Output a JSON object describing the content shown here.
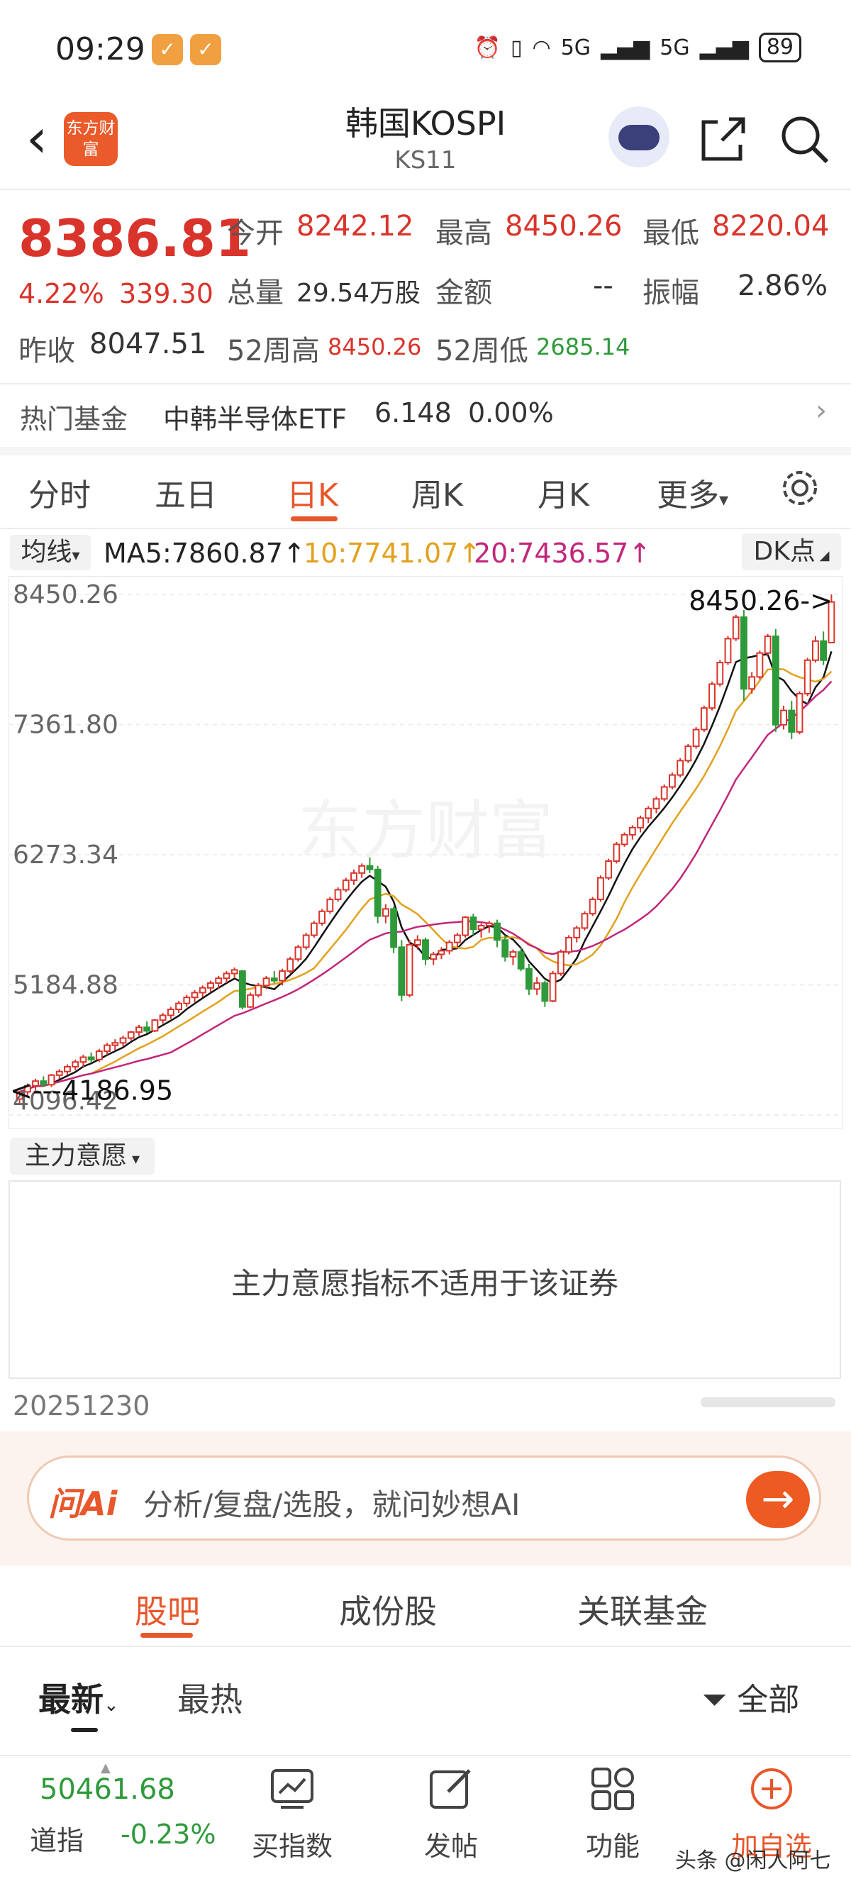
{
  "status": {
    "time": "09:29",
    "signal_1": "5G",
    "signal_2": "5G",
    "battery": "89"
  },
  "header": {
    "logo": "东方财富",
    "title": "韩国KOSPI",
    "code": "KS11"
  },
  "quote": {
    "price": "8386.81",
    "change_pct": "4.22%",
    "change_abs": "339.30",
    "open_label": "今开",
    "open": "8242.12",
    "high_label": "最高",
    "high": "8450.26",
    "low_label": "最低",
    "low": "8220.04",
    "volume_label": "总量",
    "volume": "29.54万股",
    "amount_label": "金额",
    "amount": "--",
    "amplitude_label": "振幅",
    "amplitude": "2.86%",
    "prev_close_label": "昨收",
    "prev_close": "8047.51",
    "wk52_high_label": "52周高",
    "wk52_high": "8450.26",
    "wk52_low_label": "52周低",
    "wk52_low": "2685.14"
  },
  "hot_fund": {
    "label": "热门基金",
    "name": "中韩半导体ETF",
    "price": "6.148",
    "change": "0.00%",
    "arrow": "›"
  },
  "chart_tabs": [
    "分时",
    "五日",
    "日K",
    "周K",
    "月K",
    "更多"
  ],
  "ma": {
    "selector": "均线",
    "ma5": "MA5:7860.87↑",
    "ma10": "10:7741.07↑",
    "ma20": "20:7436.57↑",
    "dk_button": "DK点"
  },
  "chart_data": {
    "type": "candlestick",
    "y_ticks": [
      "8450.26",
      "7361.80",
      "6273.34",
      "5184.88",
      "4096.42"
    ],
    "ylim": [
      4096.42,
      8450.26
    ],
    "max_annotation": "8450.26->",
    "min_annotation": "<---4186.95",
    "watermark": "东方财富",
    "series": [
      {
        "name": "MA5",
        "color": "#111111"
      },
      {
        "name": "MA10",
        "color": "#e2a11e"
      },
      {
        "name": "MA20",
        "color": "#c2267a"
      }
    ],
    "candles": [
      [
        4230,
        4300,
        4187,
        4290
      ],
      [
        4290,
        4360,
        4260,
        4340
      ],
      [
        4340,
        4400,
        4300,
        4380
      ],
      [
        4380,
        4420,
        4330,
        4350
      ],
      [
        4350,
        4440,
        4330,
        4430
      ],
      [
        4430,
        4480,
        4400,
        4460
      ],
      [
        4460,
        4520,
        4430,
        4500
      ],
      [
        4500,
        4560,
        4470,
        4540
      ],
      [
        4540,
        4600,
        4500,
        4580
      ],
      [
        4580,
        4620,
        4530,
        4560
      ],
      [
        4560,
        4650,
        4540,
        4630
      ],
      [
        4630,
        4700,
        4600,
        4680
      ],
      [
        4680,
        4730,
        4640,
        4700
      ],
      [
        4700,
        4760,
        4670,
        4740
      ],
      [
        4740,
        4800,
        4720,
        4790
      ],
      [
        4790,
        4850,
        4760,
        4830
      ],
      [
        4830,
        4880,
        4780,
        4800
      ],
      [
        4800,
        4900,
        4790,
        4890
      ],
      [
        4890,
        4950,
        4860,
        4930
      ],
      [
        4930,
        5000,
        4900,
        4980
      ],
      [
        4980,
        5050,
        4950,
        5030
      ],
      [
        5030,
        5100,
        5000,
        5080
      ],
      [
        5080,
        5140,
        5040,
        5120
      ],
      [
        5120,
        5180,
        5080,
        5160
      ],
      [
        5160,
        5220,
        5120,
        5200
      ],
      [
        5200,
        5260,
        5150,
        5240
      ],
      [
        5240,
        5300,
        5200,
        5280
      ],
      [
        5280,
        5330,
        5240,
        5310
      ],
      [
        5300,
        5310,
        4980,
        5000
      ],
      [
        5000,
        5120,
        4990,
        5100
      ],
      [
        5100,
        5200,
        5080,
        5180
      ],
      [
        5180,
        5260,
        5150,
        5240
      ],
      [
        5240,
        5300,
        5200,
        5220
      ],
      [
        5220,
        5320,
        5180,
        5300
      ],
      [
        5300,
        5420,
        5280,
        5400
      ],
      [
        5400,
        5520,
        5380,
        5500
      ],
      [
        5500,
        5620,
        5480,
        5600
      ],
      [
        5600,
        5720,
        5580,
        5700
      ],
      [
        5700,
        5820,
        5680,
        5800
      ],
      [
        5800,
        5920,
        5780,
        5900
      ],
      [
        5900,
        6000,
        5880,
        5980
      ],
      [
        5980,
        6080,
        5960,
        6060
      ],
      [
        6060,
        6150,
        6020,
        6120
      ],
      [
        6120,
        6200,
        6080,
        6180
      ],
      [
        6180,
        6250,
        6120,
        6150
      ],
      [
        6150,
        6180,
        5700,
        5760
      ],
      [
        5760,
        5860,
        5700,
        5820
      ],
      [
        5820,
        5840,
        5450,
        5500
      ],
      [
        5500,
        5560,
        5050,
        5100
      ],
      [
        5100,
        5560,
        5080,
        5520
      ],
      [
        5520,
        5600,
        5480,
        5560
      ],
      [
        5560,
        5580,
        5350,
        5400
      ],
      [
        5400,
        5460,
        5350,
        5440
      ],
      [
        5440,
        5500,
        5400,
        5470
      ],
      [
        5470,
        5560,
        5440,
        5540
      ],
      [
        5540,
        5620,
        5500,
        5600
      ],
      [
        5600,
        5760,
        5580,
        5750
      ],
      [
        5750,
        5780,
        5600,
        5650
      ],
      [
        5650,
        5700,
        5580,
        5680
      ],
      [
        5680,
        5720,
        5620,
        5700
      ],
      [
        5700,
        5730,
        5500,
        5560
      ],
      [
        5560,
        5600,
        5380,
        5420
      ],
      [
        5420,
        5480,
        5350,
        5460
      ],
      [
        5460,
        5500,
        5300,
        5320
      ],
      [
        5320,
        5360,
        5100,
        5150
      ],
      [
        5150,
        5250,
        5100,
        5200
      ],
      [
        5200,
        5220,
        5000,
        5050
      ],
      [
        5050,
        5300,
        5040,
        5280
      ],
      [
        5280,
        5480,
        5260,
        5460
      ],
      [
        5460,
        5600,
        5440,
        5580
      ],
      [
        5580,
        5680,
        5540,
        5660
      ],
      [
        5660,
        5800,
        5640,
        5780
      ],
      [
        5780,
        5920,
        5760,
        5900
      ],
      [
        5900,
        6100,
        5880,
        6080
      ],
      [
        6080,
        6240,
        6060,
        6220
      ],
      [
        6220,
        6380,
        6200,
        6360
      ],
      [
        6360,
        6460,
        6340,
        6440
      ],
      [
        6440,
        6520,
        6400,
        6500
      ],
      [
        6500,
        6600,
        6460,
        6580
      ],
      [
        6580,
        6680,
        6540,
        6660
      ],
      [
        6660,
        6760,
        6620,
        6740
      ],
      [
        6740,
        6860,
        6720,
        6840
      ],
      [
        6840,
        6960,
        6820,
        6940
      ],
      [
        6940,
        7080,
        6920,
        7060
      ],
      [
        7060,
        7200,
        7040,
        7180
      ],
      [
        7180,
        7340,
        7160,
        7320
      ],
      [
        7320,
        7520,
        7300,
        7500
      ],
      [
        7500,
        7720,
        7480,
        7700
      ],
      [
        7700,
        7900,
        7680,
        7880
      ],
      [
        7880,
        8100,
        7860,
        8080
      ],
      [
        8080,
        8280,
        8060,
        8260
      ],
      [
        8260,
        8320,
        7560,
        7660
      ],
      [
        7660,
        7800,
        7620,
        7760
      ],
      [
        7760,
        7980,
        7740,
        7960
      ],
      [
        7960,
        8120,
        7940,
        8100
      ],
      [
        8100,
        8160,
        7300,
        7360
      ],
      [
        7360,
        7520,
        7320,
        7480
      ],
      [
        7480,
        7560,
        7240,
        7300
      ],
      [
        7300,
        7640,
        7280,
        7620
      ],
      [
        7620,
        7920,
        7600,
        7900
      ],
      [
        7900,
        8100,
        7880,
        8060
      ],
      [
        8060,
        8140,
        7860,
        7900
      ],
      [
        8047,
        8450,
        8220,
        8387
      ]
    ]
  },
  "main_force": {
    "selector": "主力意愿",
    "message": "主力意愿指标不适用于该证券",
    "date": "20251230"
  },
  "ai": {
    "logo": "问Ai",
    "placeholder": "分析/复盘/选股，就问妙想AI",
    "go_icon": "→"
  },
  "bottom_tabs": [
    "股吧",
    "成份股",
    "关联基金"
  ],
  "sub_tabs": {
    "latest": "最新",
    "hot": "最热",
    "filter": "全部"
  },
  "bottom_nav": {
    "dji_value": "50461.68",
    "dji_name": "道指",
    "dji_change": "-0.23%",
    "items": [
      "买指数",
      "发帖",
      "功能",
      "加自选"
    ]
  },
  "watermark": "头条 @闲人阿七",
  "colors": {
    "accent": "#e8572b",
    "up": "#d9342b",
    "down": "#2f9a3a"
  }
}
